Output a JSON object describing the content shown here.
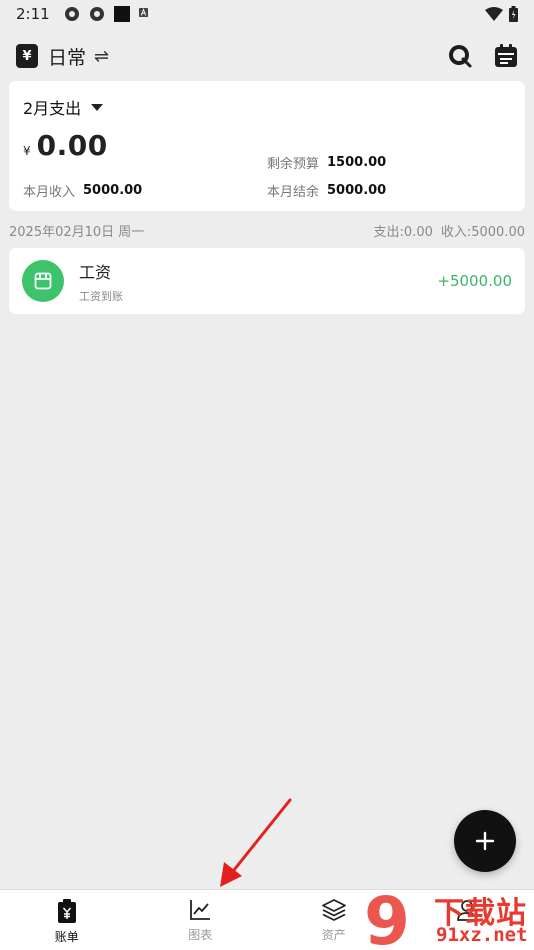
{
  "status_bar": {
    "time": "2:11"
  },
  "header": {
    "book_symbol": "¥",
    "title": "日常",
    "swap_symbol": "⇌"
  },
  "summary": {
    "month_label": "2月支出",
    "currency": "¥",
    "expense": "0.00",
    "budget_left_label": "剩余预算",
    "budget_left_value": "1500.00",
    "income_label": "本月收入",
    "income_value": "5000.00",
    "balance_label": "本月结余",
    "balance_value": "5000.00"
  },
  "day": {
    "date": "2025年02月10日 周一",
    "expense_summary": "支出:0.00",
    "income_summary": "收入:5000.00"
  },
  "transactions": [
    {
      "title": "工资",
      "note": "工资到账",
      "amount": "+5000.00"
    }
  ],
  "nav": {
    "items": [
      {
        "label": "账单",
        "icon": "clipboard-yuan-icon",
        "active": true
      },
      {
        "label": "图表",
        "icon": "line-chart-icon",
        "active": false
      },
      {
        "label": "资产",
        "icon": "layers-icon",
        "active": false
      },
      {
        "label": "",
        "icon": "person-icon",
        "active": false
      }
    ]
  },
  "watermark": {
    "logo_number": "9",
    "main": "下载站",
    "sub": "91xz.net"
  },
  "colors": {
    "accent_green": "#3cc36c",
    "annotation_red": "#e32020",
    "watermark_red": "#e8392f"
  }
}
